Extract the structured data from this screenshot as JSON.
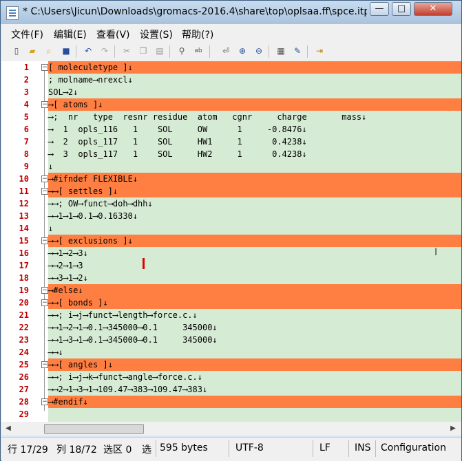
{
  "window": {
    "title": "* C:\\Users\\Jicun\\Downloads\\gromacs-2016.4\\share\\top\\oplsaa.ff\\spce.itp -...",
    "minimize": "—",
    "maximize": "□",
    "close": "✕"
  },
  "menu": [
    "文件(F)",
    "编辑(E)",
    "查看(V)",
    "设置(S)",
    "帮助(?)"
  ],
  "toolbar_icons": [
    "new-file-icon",
    "open-file-icon",
    "find-file-icon",
    "save-icon",
    "undo-icon",
    "redo-icon",
    "cut-icon",
    "copy-icon",
    "paste-icon",
    "find-icon",
    "replace-icon",
    "word-wrap-icon",
    "zoom-in-icon",
    "zoom-out-icon",
    "settings-icon",
    "pencil-icon",
    "exit-icon"
  ],
  "lines": [
    {
      "n": "1",
      "t": "[ moleculetype ]↓",
      "hl": true
    },
    {
      "n": "2",
      "t": "; molname⟶nrexcl↓",
      "hl": false
    },
    {
      "n": "3",
      "t": "SOL⟶2↓",
      "hl": false
    },
    {
      "n": "4",
      "t": "⟶[ atoms ]↓",
      "hl": true
    },
    {
      "n": "5",
      "t": "⟶;  nr   type  resnr residue  atom   cgnr     charge       mass↓",
      "hl": false
    },
    {
      "n": "6",
      "t": "⟶  1  opls_116   1    SOL     OW      1     -0.8476↓",
      "hl": false
    },
    {
      "n": "7",
      "t": "⟶  2  opls_117   1    SOL     HW1     1      0.4238↓",
      "hl": false
    },
    {
      "n": "8",
      "t": "⟶  3  opls_117   1    SOL     HW2     1      0.4238↓",
      "hl": false
    },
    {
      "n": "9",
      "t": "↓",
      "hl": false
    },
    {
      "n": "10",
      "t": "⟶#ifndef FLEXIBLE↓",
      "hl": true
    },
    {
      "n": "11",
      "t": "⟶⟶[ settles ]↓",
      "hl": true
    },
    {
      "n": "12",
      "t": "⟶⟶; OW⟶funct⟶doh⟶dhh↓",
      "hl": false
    },
    {
      "n": "13",
      "t": "⟶⟶1⟶1⟶0.1⟶0.16330↓",
      "hl": false
    },
    {
      "n": "14",
      "t": "↓",
      "hl": false
    },
    {
      "n": "15",
      "t": "⟶⟶[ exclusions ]↓",
      "hl": true
    },
    {
      "n": "16",
      "t": "⟶⟶1⟶2⟶3↓",
      "hl": false
    },
    {
      "n": "17",
      "t": "⟶⟶2⟶1⟶3",
      "hl": false
    },
    {
      "n": "18",
      "t": "⟶⟶3⟶1⟶2↓",
      "hl": false
    },
    {
      "n": "19",
      "t": "⟶#else↓",
      "hl": true
    },
    {
      "n": "20",
      "t": "⟶⟶[ bonds ]↓",
      "hl": true
    },
    {
      "n": "21",
      "t": "⟶⟶; i⟶j⟶funct⟶length⟶force.c.↓",
      "hl": false
    },
    {
      "n": "22",
      "t": "⟶⟶1⟶2⟶1⟶0.1⟶345000⟶0.1     345000↓",
      "hl": false
    },
    {
      "n": "23",
      "t": "⟶⟶1⟶3⟶1⟶0.1⟶345000⟶0.1     345000↓",
      "hl": false
    },
    {
      "n": "24",
      "t": "⟶⟶↓",
      "hl": false
    },
    {
      "n": "25",
      "t": "⟶⟶[ angles ]↓",
      "hl": true
    },
    {
      "n": "26",
      "t": "⟶⟶; i⟶j⟶k⟶funct⟶angle⟶force.c.↓",
      "hl": false
    },
    {
      "n": "27",
      "t": "⟶⟶2⟶1⟶3⟶1⟶109.47⟶383⟶109.47⟶383↓",
      "hl": false
    },
    {
      "n": "28",
      "t": "⟶#endif↓",
      "hl": true
    },
    {
      "n": "29",
      "t": "",
      "hl": false
    }
  ],
  "status": {
    "line": "行 17/29",
    "col": "列 18/72",
    "sel": "选区 0",
    "sel2": "选",
    "size": "595 bytes",
    "encoding": "UTF-8",
    "eol": "LF",
    "mode": "INS",
    "scheme": "Configuration"
  },
  "colors": {
    "highlight": "#ff7f42",
    "background": "#d6ebd4",
    "line_number": "#c00000"
  }
}
